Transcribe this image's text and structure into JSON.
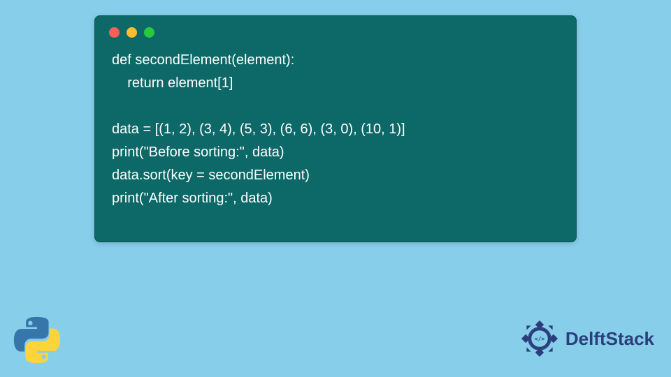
{
  "code": {
    "lines": [
      "def secondElement(element):",
      "    return element[1]",
      "",
      "data = [(1, 2), (3, 4), (5, 3), (6, 6), (3, 0), (10, 1)]",
      "print(\"Before sorting:\", data)",
      "data.sort(key = secondElement)",
      "print(\"After sorting:\", data)"
    ]
  },
  "branding": {
    "name": "DelftStack"
  },
  "colors": {
    "background": "#87ceeb",
    "window": "#0d6868",
    "red": "#ff5f56",
    "yellow": "#ffbd2e",
    "green": "#27c93f"
  }
}
